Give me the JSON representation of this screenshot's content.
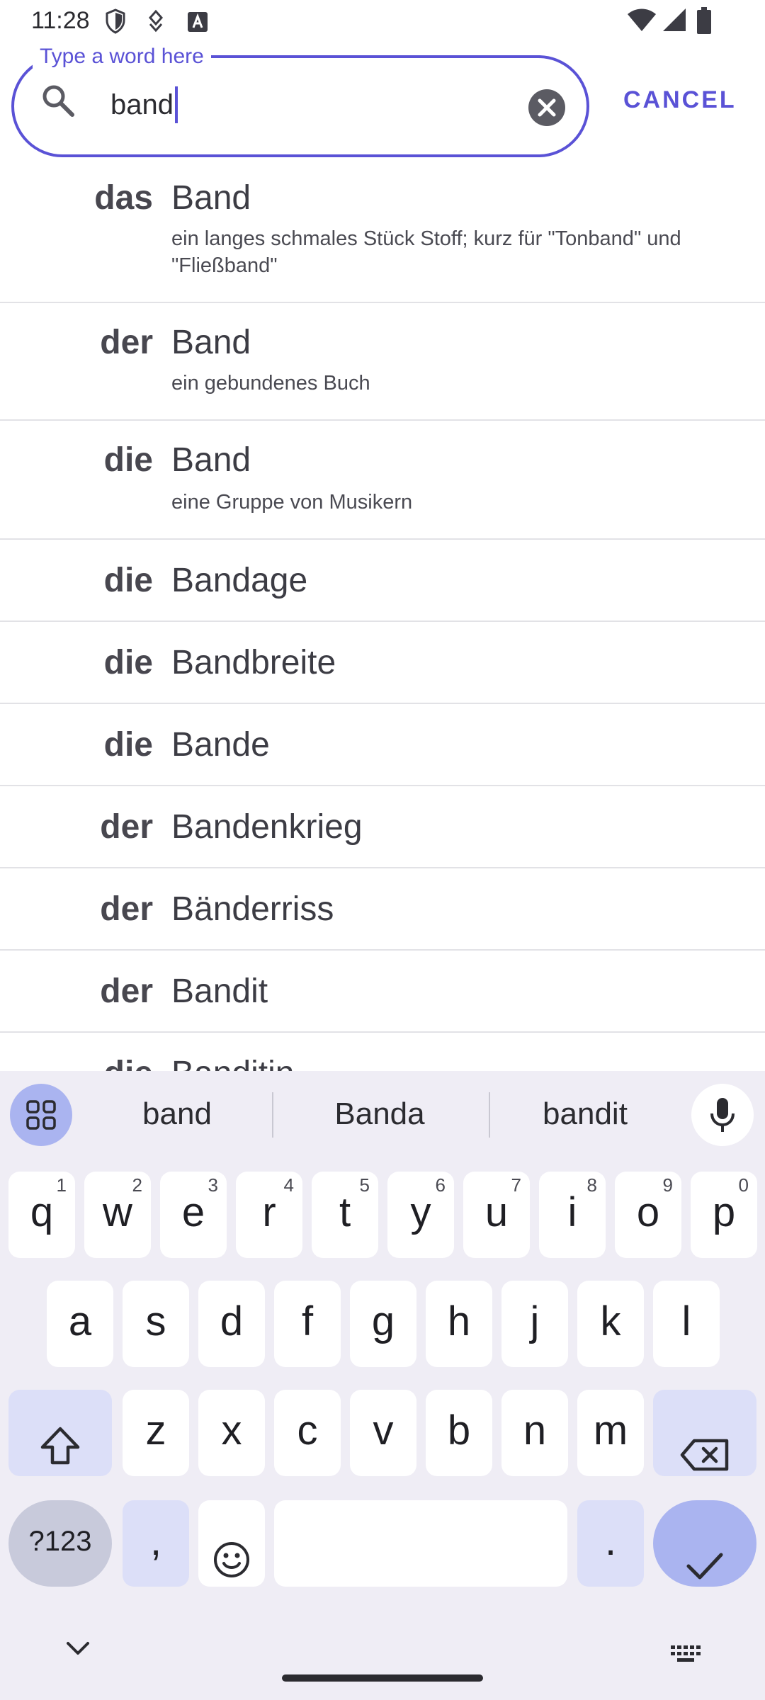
{
  "status_bar": {
    "time": "11:28",
    "icons": [
      "shield-icon",
      "data-saver-icon",
      "a-badge-icon",
      "wifi-icon",
      "signal-icon",
      "battery-icon"
    ]
  },
  "search": {
    "legend": "Type a word here",
    "value": "band",
    "cancel_label": "CANCEL",
    "accent": "#5a52d6"
  },
  "results": [
    {
      "article": "das",
      "word": "Band",
      "definition": "ein langes schmales Stück Stoff; kurz für \"Tonband\" und \"Fließband\""
    },
    {
      "article": "der",
      "word": "Band",
      "definition": "ein gebundenes Buch"
    },
    {
      "article": "die",
      "word": "Band",
      "definition": "eine Gruppe von Musikern"
    },
    {
      "article": "die",
      "word": "Bandage",
      "definition": ""
    },
    {
      "article": "die",
      "word": "Bandbreite",
      "definition": ""
    },
    {
      "article": "die",
      "word": "Bande",
      "definition": ""
    },
    {
      "article": "der",
      "word": "Bandenkrieg",
      "definition": ""
    },
    {
      "article": "der",
      "word": "Bänderriss",
      "definition": ""
    },
    {
      "article": "der",
      "word": "Bandit",
      "definition": ""
    },
    {
      "article": "die",
      "word": "Banditin",
      "definition": ""
    }
  ],
  "keyboard": {
    "suggestions": [
      "band",
      "Banda",
      "bandit"
    ],
    "row1": [
      {
        "key": "q",
        "hint": "1"
      },
      {
        "key": "w",
        "hint": "2"
      },
      {
        "key": "e",
        "hint": "3"
      },
      {
        "key": "r",
        "hint": "4"
      },
      {
        "key": "t",
        "hint": "5"
      },
      {
        "key": "y",
        "hint": "6"
      },
      {
        "key": "u",
        "hint": "7"
      },
      {
        "key": "i",
        "hint": "8"
      },
      {
        "key": "o",
        "hint": "9"
      },
      {
        "key": "p",
        "hint": "0"
      }
    ],
    "row2": [
      "a",
      "s",
      "d",
      "f",
      "g",
      "h",
      "j",
      "k",
      "l"
    ],
    "row3": [
      "z",
      "x",
      "c",
      "v",
      "b",
      "n",
      "m"
    ],
    "symbols_label": "?123",
    "comma_label": ",",
    "period_label": ".",
    "colors": {
      "background": "#efedf5",
      "special_key": "#dcdff8",
      "accent_key": "#aab4f0"
    }
  }
}
